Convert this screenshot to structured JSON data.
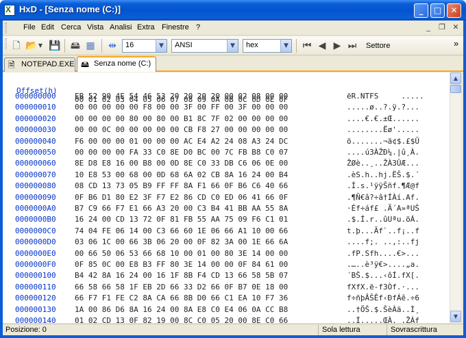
{
  "window": {
    "title": "HxD - [Senza nome (C:)]",
    "caption_min": "_",
    "caption_max": "□",
    "caption_close": "✕"
  },
  "menu": {
    "items": [
      "File",
      "Edit",
      "Cerca",
      "Vista",
      "Analisi",
      "Extra",
      "Finestre",
      "?"
    ],
    "mdi_min": "_",
    "mdi_restore": "❐",
    "mdi_close": "✕"
  },
  "toolbar": {
    "bytes_per_row": "16",
    "charset": "ANSI",
    "offset_base": "hex",
    "sector_label": "Settore",
    "overflow": "»"
  },
  "tabs": [
    {
      "label": "NOTEPAD.EXE",
      "active": false
    },
    {
      "label": "Senza nome (C:)",
      "active": true
    }
  ],
  "editor": {
    "header_offset": "Offset(h)",
    "header_cols": "00 01 02 03 04 05 06 07 08 09 0A 0B 0C 0D 0E 0F",
    "rows": [
      {
        "off": "000000000",
        "hex": "EB 52 90 4E 54 46 53 20 20 20 20 00 02 08 00 00",
        "txt": "ëR.NTFS     ....."
      },
      {
        "off": "000000010",
        "hex": "00 00 00 00 00 F8 00 00 3F 00 FF 00 3F 00 00 00",
        "txt": ".....ø..?.ÿ.?..."
      },
      {
        "off": "000000020",
        "hex": "00 00 00 00 80 00 80 00 B1 8C 7F 02 00 00 00 00",
        "txt": "....€.€.±Œ......"
      },
      {
        "off": "000000030",
        "hex": "00 00 0C 00 00 00 00 00 CB F8 27 00 00 00 00 00",
        "txt": "........Ëø'....."
      },
      {
        "off": "000000040",
        "hex": "F6 00 00 00 01 00 00 00 AC E4 A2 24 08 A3 24 DC",
        "txt": "ö.......¬ä¢$.£$Ü"
      },
      {
        "off": "000000050",
        "hex": "00 00 00 00 FA 33 C0 8E D0 BC 00 7C FB B8 C0 07",
        "txt": "....ú3ÀŽÐ¼.|û¸À."
      },
      {
        "off": "000000060",
        "hex": "8E D8 E8 16 00 B8 00 0D 8E C0 33 DB C6 06 0E 00",
        "txt": "ŽØè..¸..ŽÀ3ÛÆ..."
      },
      {
        "off": "000000070",
        "hex": "10 E8 53 00 68 00 0D 68 6A 02 CB 8A 16 24 00 B4",
        "txt": ".èS.h..hj.ËŠ.$.´"
      },
      {
        "off": "000000080",
        "hex": "08 CD 13 73 05 B9 FF FF 8A F1 66 0F B6 C6 40 66",
        "txt": ".Í.s.¹ÿÿŠñf.¶Æ@f"
      },
      {
        "off": "000000090",
        "hex": "0F B6 D1 80 E2 3F F7 E2 86 CD C0 ED 06 41 66 0F",
        "txt": ".¶Ñ€â?÷â†ÍÀí.Af."
      },
      {
        "off": "0000000A0",
        "hex": "B7 C9 66 F7 E1 66 A3 20 00 C3 B4 41 BB AA 55 8A",
        "txt": "·Éf÷áf£ .Ã´A»ªUŠ"
      },
      {
        "off": "0000000B0",
        "hex": "16 24 00 CD 13 72 0F 81 FB 55 AA 75 09 F6 C1 01",
        "txt": ".$.Í.r..ûUªu.öÁ."
      },
      {
        "off": "0000000C0",
        "hex": "74 04 FE 06 14 00 C3 66 60 1E 06 66 A1 10 00 66",
        "txt": "t.þ...Ãf`..f¡..f"
      },
      {
        "off": "0000000D0",
        "hex": "03 06 1C 00 66 3B 06 20 00 0F 82 3A 00 1E 66 6A",
        "txt": "....f;. ..‚:..fj"
      },
      {
        "off": "0000000E0",
        "hex": "00 66 50 06 53 66 68 10 00 01 00 80 3E 14 00 00",
        "txt": ".fP.Sfh....€>..."
      },
      {
        "off": "0000000F0",
        "hex": "0F 85 0C 00 E8 B3 FF 80 3E 14 00 00 0F 84 61 00",
        "txt": ".…..è³ÿ€>....„a."
      },
      {
        "off": "000000100",
        "hex": "B4 42 8A 16 24 00 16 1F 8B F4 CD 13 66 58 5B 07",
        "txt": "´BŠ.$...‹ôÍ.fX[."
      },
      {
        "off": "000000110",
        "hex": "66 58 66 58 1F EB 2D 66 33 D2 66 0F B7 0E 18 00",
        "txt": "fXfX.ë-f3Òf.·..."
      },
      {
        "off": "000000120",
        "hex": "66 F7 F1 FE C2 8A CA 66 8B D0 66 C1 EA 10 F7 36",
        "txt": "f÷ñþÂŠÊf‹ÐfÁê.÷6"
      },
      {
        "off": "000000130",
        "hex": "1A 00 86 D6 8A 16 24 00 8A E8 C0 E4 06 0A CC B8",
        "txt": "..†ÖŠ.$.ŠèÀä..Ì¸"
      },
      {
        "off": "000000140",
        "hex": "01 02 CD 13 0F 82 19 00 8C C0 05 20 00 8E C0 66",
        "txt": "..Í..‚..ŒÀ. .ŽÀf"
      }
    ]
  },
  "status": {
    "position": "Posizione: 0",
    "mode": "Sola lettura",
    "overwrite": "Sovrascrittura"
  }
}
